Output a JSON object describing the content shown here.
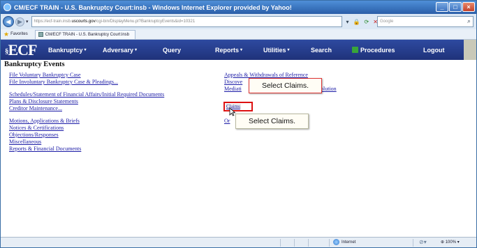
{
  "browser": {
    "title": "CM/ECF TRAIN - U.S. Bankruptcy Court:insb - Windows Internet Explorer provided by Yahoo!",
    "url_prefix": "https://ecf-train.insb.",
    "url_host": "uscourts.gov",
    "url_rest": "/cgi-bin/DisplayMenu.pl?BankruptcyEvents&id=10321",
    "search_placeholder": "Google",
    "favorites_label": "Favorites",
    "tab_label": "CM/ECF TRAIN - U.S. Bankruptcy Court:insb",
    "status_internet": "Internet",
    "zoom_level": "100%"
  },
  "ecf_nav": {
    "logo_prefix": "§",
    "logo_text": "ECF",
    "items": [
      {
        "label": "Bankruptcy",
        "caret": "▾"
      },
      {
        "label": "Adversary",
        "caret": "▾"
      },
      {
        "label": "Query",
        "caret": ""
      },
      {
        "label": "Reports",
        "caret": "▾"
      },
      {
        "label": "Utilities",
        "caret": "▾"
      },
      {
        "label": "Search",
        "caret": ""
      },
      {
        "label": "Procedures",
        "caret": ""
      },
      {
        "label": "Logout",
        "caret": ""
      }
    ]
  },
  "page": {
    "heading": "Bankruptcy Events",
    "left_links": {
      "group1": [
        "File Voluntary Bankruptcy Case",
        "File Involuntary Bankruptcy Case & Pleadings..."
      ],
      "group2": [
        "Schedules/Statement of Financial Affairs/Initial Required Documents",
        "Plans & Disclosure Statements",
        "Creditor Maintenance..."
      ],
      "group3": [
        "Motions, Applications & Briefs",
        "Notices & Certifications",
        "Objections/Responses",
        "Miscellaneous",
        "Reports & Financial Documents"
      ]
    },
    "right_links": {
      "appeals": "Appeals & Withdrawals of Reference",
      "discovery": "Discove",
      "mediation": "Mediati",
      "resolution": "olution",
      "claims": "Claims",
      "orders": "Or"
    },
    "callout_top": "Select Claims.",
    "callout_bottom": "Select Claims."
  }
}
